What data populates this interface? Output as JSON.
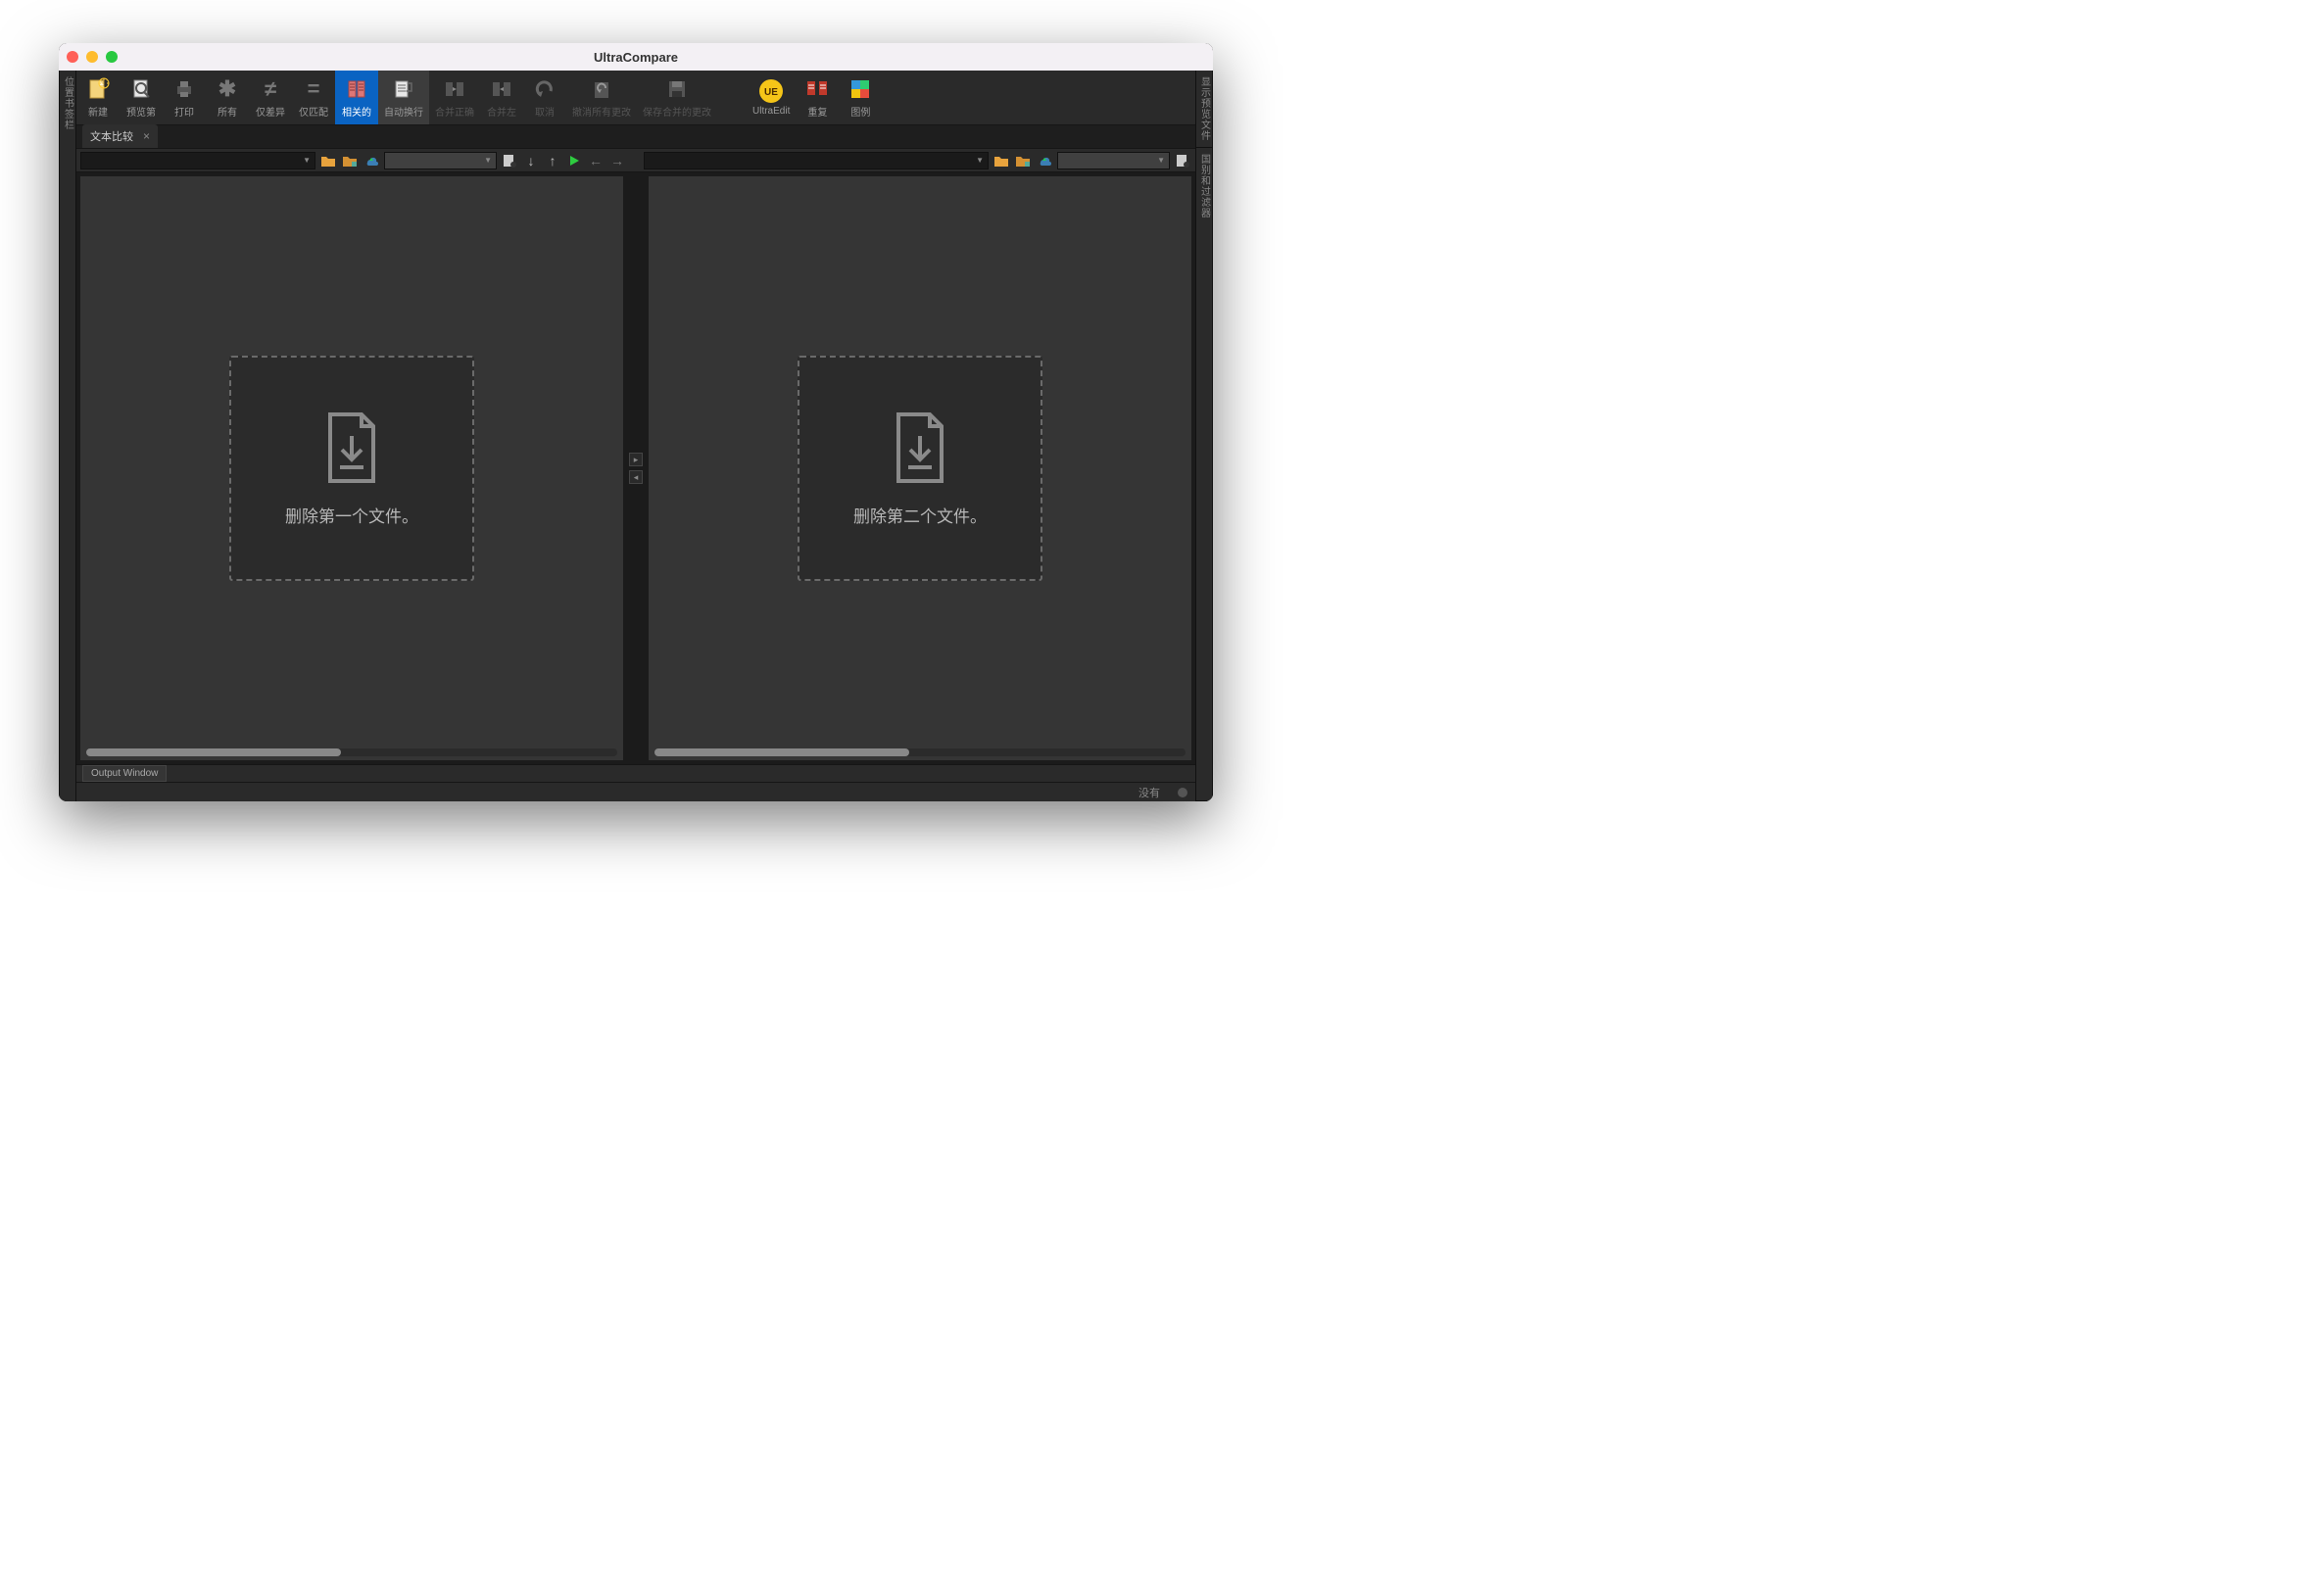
{
  "window": {
    "title": "UltraCompare"
  },
  "toolbar": {
    "new": "新建",
    "preview": "预览第",
    "print": "打印",
    "all": "所有",
    "diff_only": "仅差异",
    "match_only": "仅匹配",
    "related": "相关的",
    "autowrap": "自动换行",
    "merge_right": "合并正确",
    "merge_left": "合并左",
    "cancel": "取消",
    "undo_all": "撤消所有更改",
    "save_merge": "保存合并的更改",
    "ultraedit": "UltraEdit",
    "repeat": "重复",
    "legend": "图例"
  },
  "left_side_tab": "位置书签栏",
  "right_side_tab_1": "显示预览文件",
  "right_side_tab_2": "国别和过滤器",
  "tab": {
    "label": "文本比较"
  },
  "drop": {
    "left": "删除第一个文件。",
    "right": "删除第二个文件。"
  },
  "bottom_tab": "Output Window",
  "status": {
    "right": "没有"
  }
}
